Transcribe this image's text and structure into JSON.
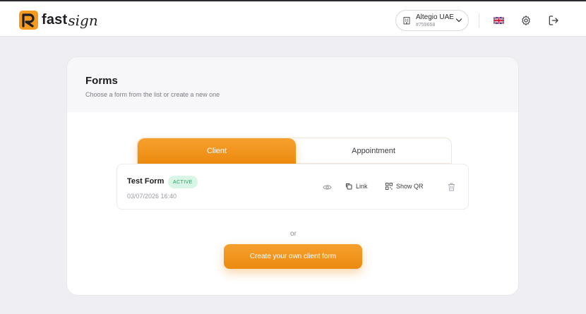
{
  "header": {
    "logo": {
      "brand_a": "fast",
      "brand_b": "sign"
    },
    "account": {
      "name": "Altegio UAE",
      "id": "#759658"
    },
    "language_icon": "uk-flag-icon",
    "settings_icon": "gear-icon",
    "logout_icon": "logout-icon"
  },
  "forms": {
    "title": "Forms",
    "subtitle": "Choose a form from the list or create a new one",
    "tabs": [
      {
        "label": "Client",
        "active": true
      },
      {
        "label": "Appointment",
        "active": false
      }
    ],
    "items": [
      {
        "name": "Test Form",
        "status": "ACTIVE",
        "date": "03/07/2026 16:40",
        "actions": {
          "link": "Link",
          "qr": "Show QR"
        }
      }
    ],
    "or_label": "or",
    "create_button": "Create your own client form"
  },
  "colors": {
    "accent": "#ef8f14",
    "active_badge_bg": "#d9f5e6",
    "active_badge_text": "#22a05f",
    "page_bg": "#efeff3"
  }
}
